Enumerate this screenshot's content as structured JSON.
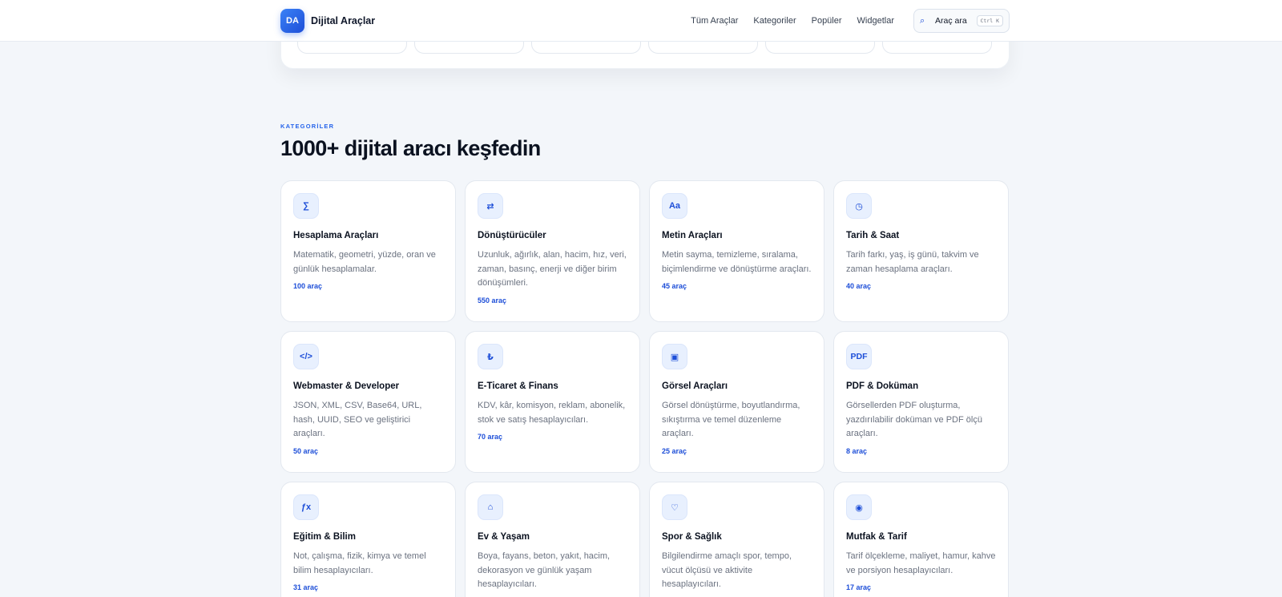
{
  "header": {
    "logo_initials": "DA",
    "brand": "Dijital Araçlar",
    "nav": [
      "Tüm Araçlar",
      "Kategoriler",
      "Popüler",
      "Widgetlar"
    ],
    "search": {
      "label": "Araç ara",
      "shortcut": "Ctrl K",
      "icon": "search-icon"
    }
  },
  "section": {
    "eyebrow": "KATEGORİLER",
    "title": "1000+ dijital aracı keşfedin"
  },
  "categories": [
    {
      "icon": "∑",
      "icon_name": "sigma-icon",
      "title": "Hesaplama Araçları",
      "desc": "Matematik, geometri, yüzde, oran ve günlük hesaplamalar.",
      "count": "100 araç"
    },
    {
      "icon": "⇄",
      "icon_name": "convert-arrows-icon",
      "title": "Dönüştürücüler",
      "desc": "Uzunluk, ağırlık, alan, hacim, hız, veri, zaman, basınç, enerji ve diğer birim dönüşümleri.",
      "count": "550 araç"
    },
    {
      "icon": "Aa",
      "icon_name": "text-icon",
      "title": "Metin Araçları",
      "desc": "Metin sayma, temizleme, sıralama, biçimlendirme ve dönüştürme araçları.",
      "count": "45 araç"
    },
    {
      "icon": "◷",
      "icon_name": "clock-icon",
      "title": "Tarih & Saat",
      "desc": "Tarih farkı, yaş, iş günü, takvim ve zaman hesaplama araçları.",
      "count": "40 araç"
    },
    {
      "icon": "</>",
      "icon_name": "code-icon",
      "title": "Webmaster & Developer",
      "desc": "JSON, XML, CSV, Base64, URL, hash, UUID, SEO ve geliştirici araçları.",
      "count": "50 araç"
    },
    {
      "icon": "₺",
      "icon_name": "lira-icon",
      "title": "E-Ticaret & Finans",
      "desc": "KDV, kâr, komisyon, reklam, abonelik, stok ve satış hesaplayıcıları.",
      "count": "70 araç"
    },
    {
      "icon": "▣",
      "icon_name": "image-icon",
      "title": "Görsel Araçları",
      "desc": "Görsel dönüştürme, boyutlandırma, sıkıştırma ve temel düzenleme araçları.",
      "count": "25 araç"
    },
    {
      "icon": "PDF",
      "icon_name": "pdf-icon",
      "title": "PDF & Doküman",
      "desc": "Görsellerden PDF oluşturma, yazdırılabilir doküman ve PDF ölçü araçları.",
      "count": "8 araç"
    },
    {
      "icon": "ƒx",
      "icon_name": "function-icon",
      "title": "Eğitim & Bilim",
      "desc": "Not, çalışma, fizik, kimya ve temel bilim hesaplayıcıları.",
      "count": "31 araç"
    },
    {
      "icon": "⌂",
      "icon_name": "home-icon",
      "title": "Ev & Yaşam",
      "desc": "Boya, fayans, beton, yakıt, hacim, dekorasyon ve günlük yaşam hesaplayıcıları.",
      "count": ""
    },
    {
      "icon": "♡",
      "icon_name": "heart-icon",
      "title": "Spor & Sağlık",
      "desc": "Bilgilendirme amaçlı spor, tempo, vücut ölçüsü ve aktivite hesaplayıcıları.",
      "count": ""
    },
    {
      "icon": "◉",
      "icon_name": "bowl-icon",
      "title": "Mutfak & Tarif",
      "desc": "Tarif ölçekleme, maliyet, hamur, kahve ve porsiyon hesaplayıcıları.",
      "count": "17 araç"
    }
  ],
  "colors": {
    "accent": "#2563eb",
    "background": "#f3f6fa",
    "card_icon_bg": "#e8f0fe"
  }
}
